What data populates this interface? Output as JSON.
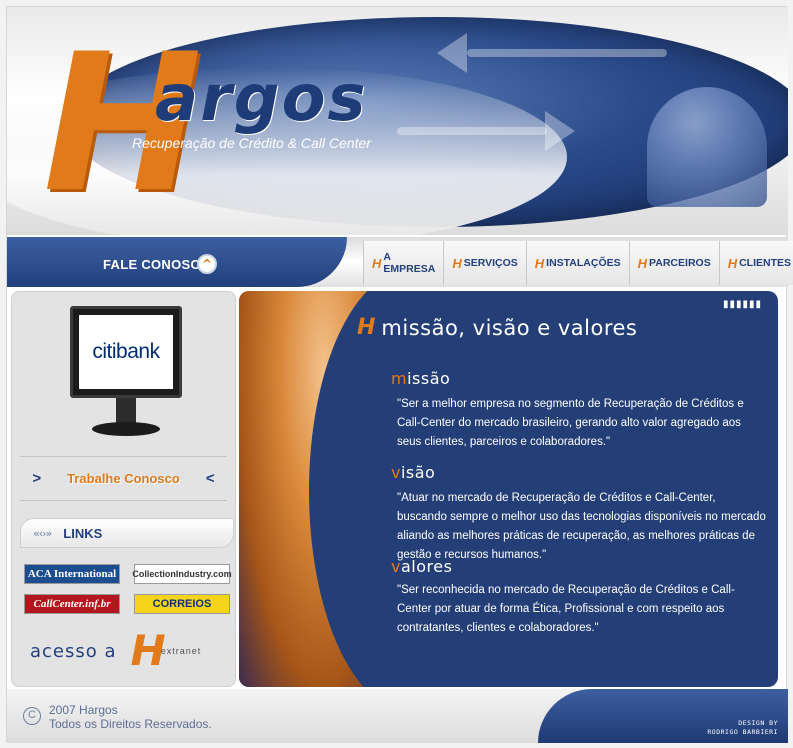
{
  "brand": {
    "logo_letter": "H",
    "logo_word": "argos",
    "tagline": "Recuperação de Crédito & Call Center",
    "accent_color": "#e07a1a",
    "primary_color": "#23407d"
  },
  "nav": {
    "contact_label": "FALE CONOSCO",
    "items": [
      {
        "label": "A EMPRESA"
      },
      {
        "label": "SERVIÇOS"
      },
      {
        "label": "INSTALAÇÕES"
      },
      {
        "label": "PARCEIROS"
      },
      {
        "label": "CLIENTES"
      }
    ]
  },
  "sidebar": {
    "featured_client": "citibank",
    "work_with_us": "Trabalhe Conosco",
    "links_title": "LINKS",
    "partners": [
      {
        "name": "ACA International"
      },
      {
        "name": "CollectionIndustry.com"
      },
      {
        "name": "CallCenter.inf.br"
      },
      {
        "name": "CORREIOS"
      }
    ],
    "access_label": "acesso a",
    "access_logo_letter": "H",
    "access_logo_word": "extranet"
  },
  "main": {
    "title": "missão, visão e valores",
    "sections": [
      {
        "initial": "m",
        "rest": "issão",
        "text": "\"Ser a melhor empresa no segmento de Recuperação de Créditos e Call-Center do mercado brasileiro, gerando alto valor agregado aos seus clientes, parceiros e colaboradores.\""
      },
      {
        "initial": "v",
        "rest": "isão",
        "text": "\"Atuar no mercado de Recuperação de Créditos e Call-Center, buscando sempre o melhor uso das tecnologias disponíveis no mercado aliando as melhores práticas de recuperação, as melhores práticas de  gestão e  recursos humanos.\""
      },
      {
        "initial": "v",
        "rest": "alores",
        "text": "\"Ser reconhecida no mercado de Recuperação de Créditos e Call-Center por atuar de forma Ética, Profissional e com respeito aos contratantes, clientes e colaboradores.\""
      }
    ]
  },
  "footer": {
    "copyright_symbol": "C",
    "line1": "2007 Hargos",
    "line2": "Todos os Direitos Reservados.",
    "design_line1": "DESIGN BY",
    "design_line2": "RODRIGO BARBIERI"
  }
}
